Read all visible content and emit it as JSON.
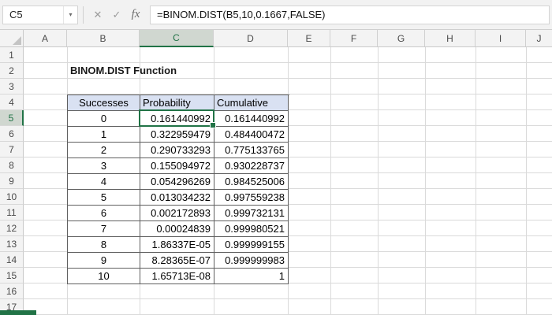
{
  "formula_bar": {
    "name_box": "C5",
    "name_dropdown": "▾",
    "cancel": "✕",
    "confirm": "✓",
    "fx": "fx",
    "formula": "=BINOM.DIST(B5,10,0.1667,FALSE)"
  },
  "sheet": {
    "columns": [
      "A",
      "B",
      "C",
      "D",
      "E",
      "F",
      "G",
      "H",
      "I",
      "J"
    ],
    "rows": [
      "1",
      "2",
      "3",
      "4",
      "5",
      "6",
      "7",
      "8",
      "9",
      "10",
      "11",
      "12",
      "13",
      "14",
      "15",
      "16",
      "17"
    ],
    "selected_cell": "C5",
    "selected_column": "C",
    "selected_row": "5"
  },
  "content": {
    "title": "BINOM.DIST Function",
    "table": {
      "headers": [
        "Successes",
        "Probability",
        "Cumulative"
      ],
      "rows": [
        {
          "successes": "0",
          "probability": "0.161440992",
          "cumulative": "0.161440992"
        },
        {
          "successes": "1",
          "probability": "0.322959479",
          "cumulative": "0.484400472"
        },
        {
          "successes": "2",
          "probability": "0.290733293",
          "cumulative": "0.775133765"
        },
        {
          "successes": "3",
          "probability": "0.155094972",
          "cumulative": "0.930228737"
        },
        {
          "successes": "4",
          "probability": "0.054296269",
          "cumulative": "0.984525006"
        },
        {
          "successes": "5",
          "probability": "0.013034232",
          "cumulative": "0.997559238"
        },
        {
          "successes": "6",
          "probability": "0.002172893",
          "cumulative": "0.999732131"
        },
        {
          "successes": "7",
          "probability": "0.00024839",
          "cumulative": "0.999980521"
        },
        {
          "successes": "8",
          "probability": "1.86337E-05",
          "cumulative": "0.999999155"
        },
        {
          "successes": "9",
          "probability": "8.28365E-07",
          "cumulative": "0.999999983"
        },
        {
          "successes": "10",
          "probability": "1.65713E-08",
          "cumulative": "1"
        }
      ]
    }
  },
  "colors": {
    "accent_green": "#217346",
    "table_header_fill": "#D9E1F2",
    "gridline": "#DADADA"
  }
}
